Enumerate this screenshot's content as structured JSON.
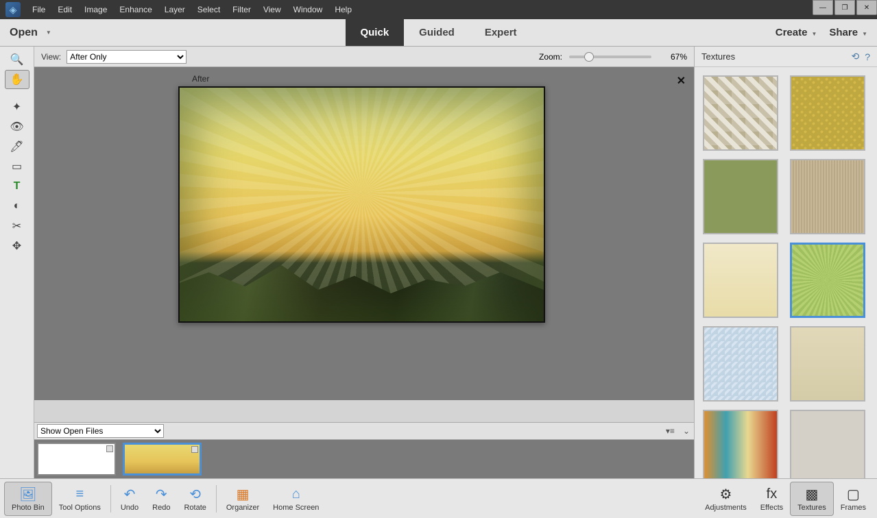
{
  "menubar": [
    "File",
    "Edit",
    "Image",
    "Enhance",
    "Layer",
    "Select",
    "Filter",
    "View",
    "Window",
    "Help"
  ],
  "tabbar": {
    "open": "Open",
    "modes": [
      "Quick",
      "Guided",
      "Expert"
    ],
    "active_mode": "Quick",
    "create": "Create",
    "share": "Share"
  },
  "optbar": {
    "view_label": "View:",
    "view_value": "After Only",
    "zoom_label": "Zoom:",
    "zoom_value": "67%"
  },
  "canvas": {
    "after_label": "After"
  },
  "binbar": {
    "dropdown": "Show Open Files"
  },
  "bottombar": {
    "left": [
      "Photo Bin",
      "Tool Options",
      "Undo",
      "Redo",
      "Rotate",
      "Organizer",
      "Home Screen"
    ],
    "right": [
      "Adjustments",
      "Effects",
      "Textures",
      "Frames"
    ],
    "right_active": "Textures"
  },
  "rightpanel": {
    "title": "Textures"
  },
  "tools": [
    {
      "name": "zoom-tool",
      "glyph": "🔍"
    },
    {
      "name": "hand-tool",
      "glyph": "✋"
    },
    {
      "name": "",
      "glyph": ""
    },
    {
      "name": "quick-select-tool",
      "glyph": "✦"
    },
    {
      "name": "redeye-tool",
      "glyph": "👁"
    },
    {
      "name": "whiten-tool",
      "glyph": "🖊"
    },
    {
      "name": "straighten-tool",
      "glyph": "▭"
    },
    {
      "name": "type-tool",
      "glyph": "T"
    },
    {
      "name": "spot-heal-tool",
      "glyph": "◐"
    },
    {
      "name": "crop-tool",
      "glyph": "✂"
    },
    {
      "name": "move-tool",
      "glyph": "✥"
    }
  ],
  "bottom_icons": {
    "Photo Bin": "🖼",
    "Tool Options": "≡",
    "Undo": "↶",
    "Redo": "↷",
    "Rotate": "⟲",
    "Organizer": "▦",
    "Home Screen": "⌂",
    "Adjustments": "⚙",
    "Effects": "fx",
    "Textures": "▩",
    "Frames": "▢"
  }
}
